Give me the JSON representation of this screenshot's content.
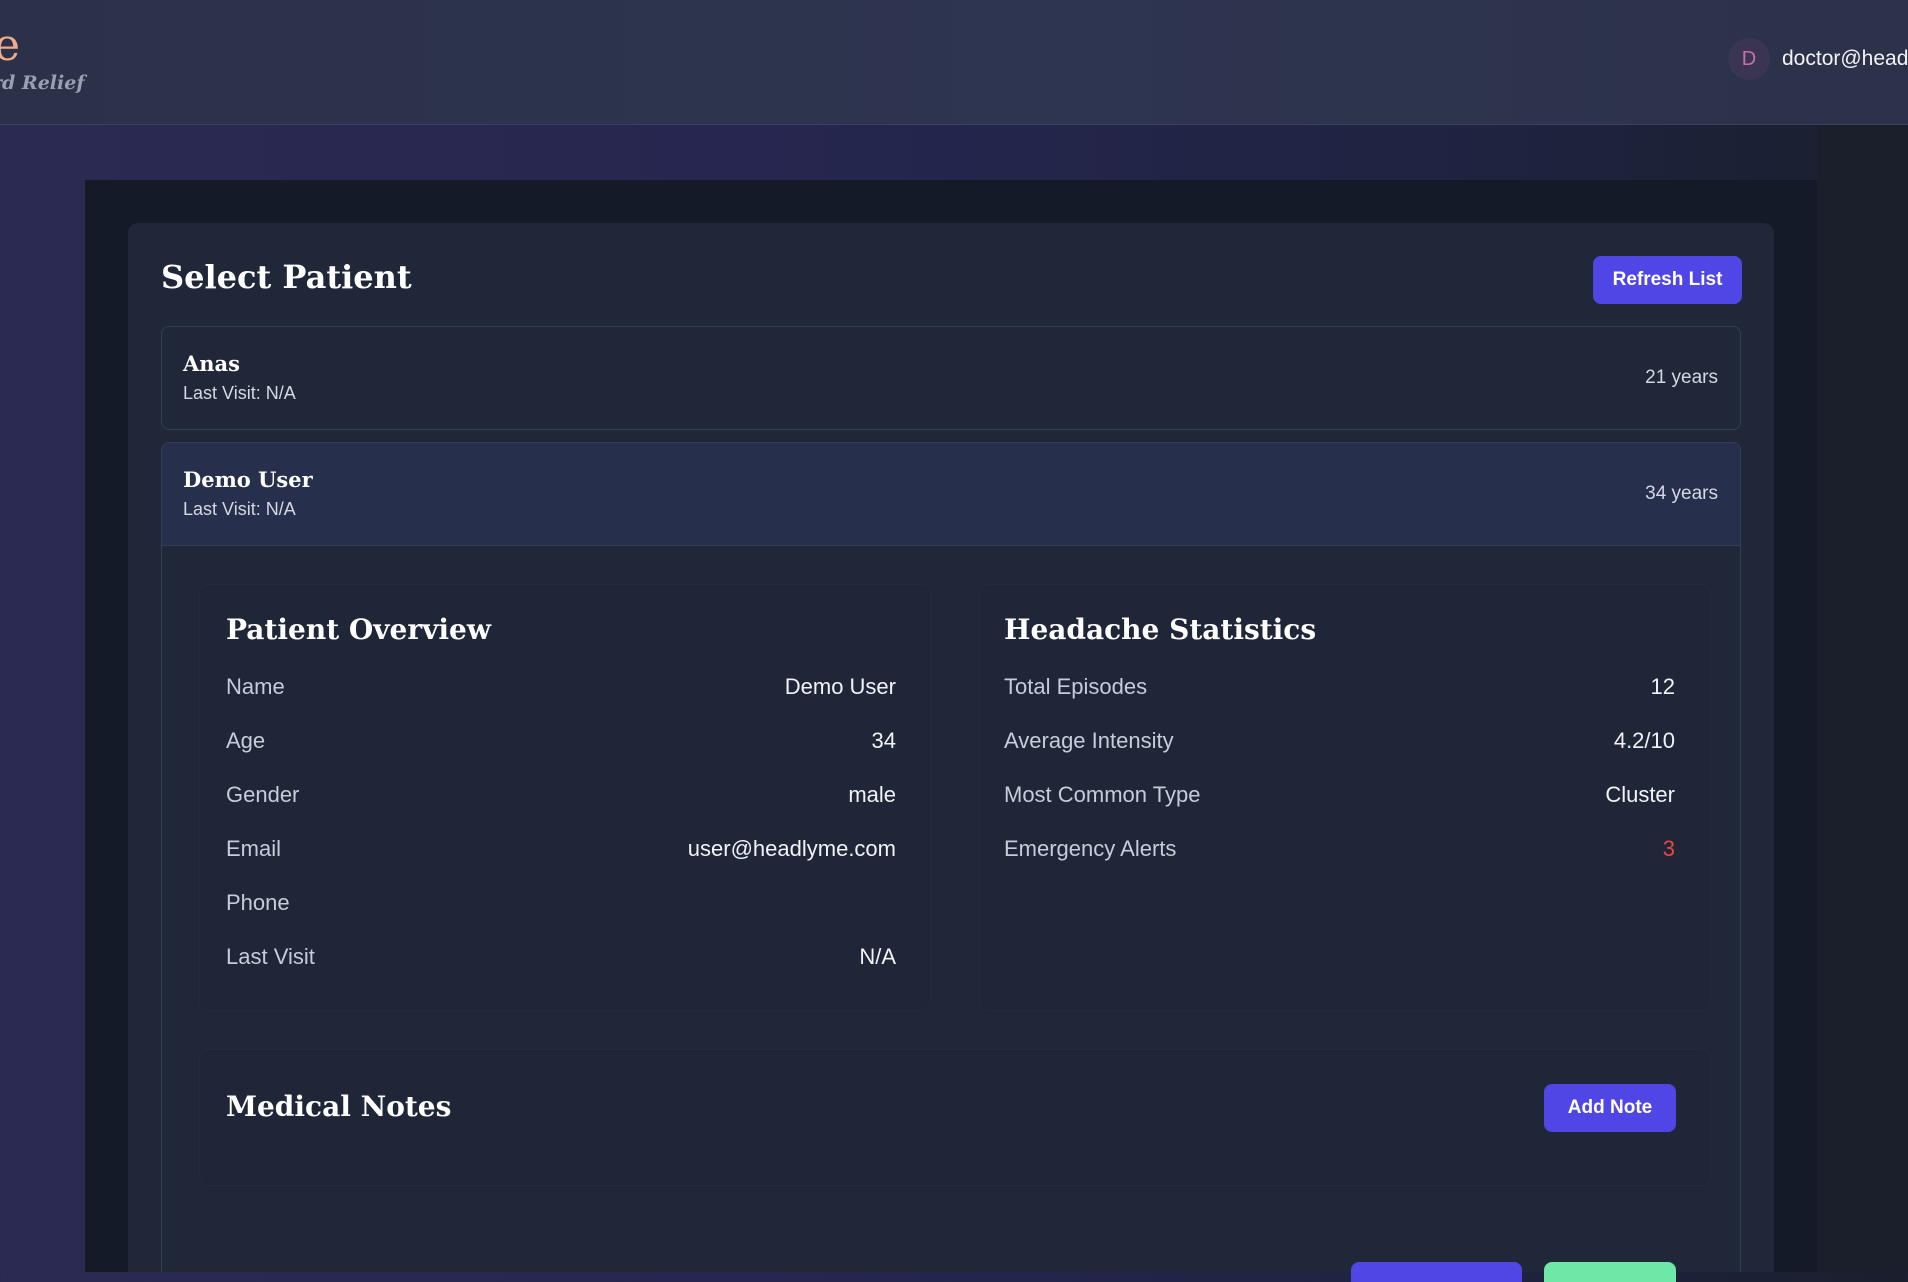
{
  "header": {
    "brand_title": "e",
    "brand_tagline": "rd Relief",
    "user_initial": "D",
    "user_email": "doctor@head"
  },
  "patient_select": {
    "title": "Select Patient",
    "refresh_label": "Refresh List",
    "patients": [
      {
        "name": "Anas",
        "last_visit": "Last Visit: N/A",
        "age": "21 years"
      },
      {
        "name": "Demo User",
        "last_visit": "Last Visit: N/A",
        "age": "34 years"
      }
    ]
  },
  "overview": {
    "title": "Patient Overview",
    "rows": [
      {
        "label": "Name",
        "value": "Demo User"
      },
      {
        "label": "Age",
        "value": "34"
      },
      {
        "label": "Gender",
        "value": "male"
      },
      {
        "label": "Email",
        "value": "user@headlyme.com"
      },
      {
        "label": "Phone",
        "value": ""
      },
      {
        "label": "Last Visit",
        "value": "N/A"
      }
    ]
  },
  "statistics": {
    "title": "Headache Statistics",
    "rows": [
      {
        "label": "Total Episodes",
        "value": "12"
      },
      {
        "label": "Average Intensity",
        "value": "4.2/10"
      },
      {
        "label": "Most Common Type",
        "value": "Cluster"
      },
      {
        "label": "Emergency Alerts",
        "value": "3"
      }
    ]
  },
  "notes": {
    "title": "Medical Notes",
    "add_label": "Add Note"
  },
  "colors": {
    "accent": "#4f46e5",
    "alert": "#ef4444",
    "success": "#6ee7a7",
    "brand": "#f0a98a"
  }
}
